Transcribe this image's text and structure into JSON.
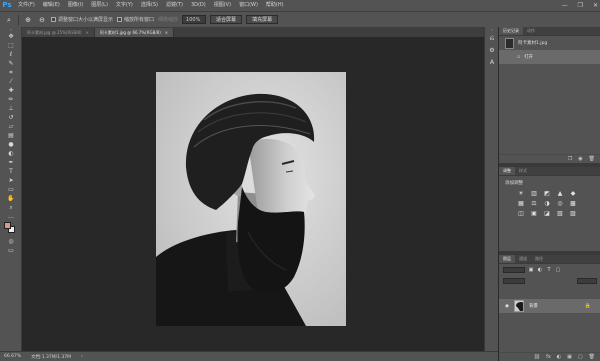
{
  "app": {
    "logo": "Ps"
  },
  "menu": {
    "items": [
      "文件(F)",
      "编辑(E)",
      "图像(I)",
      "图层(L)",
      "文字(Y)",
      "选择(S)",
      "滤镜(T)",
      "3D(D)",
      "视图(V)",
      "窗口(W)",
      "帮助(H)"
    ],
    "window_controls": [
      "—",
      "❐",
      "✕"
    ]
  },
  "options_bar": {
    "resize_windows_label": "调整窗口大小以满屏显示",
    "zoom_all_windows_label": "缩放所有窗口",
    "scrubby_zoom_label": "细微缩放",
    "zoom_value": "100%",
    "fit_screen_label": "适合屏幕",
    "fill_screen_label": "填充屏幕"
  },
  "tabs": [
    {
      "label": "阿卡素材.jpg @ 25%(RGB/8)",
      "active": false
    },
    {
      "label": "阿卡素材1.jpg @ 66.7%(RGB/8)",
      "active": true
    }
  ],
  "tools": [
    {
      "icon": "move-icon",
      "glyph": "✥"
    },
    {
      "icon": "marquee-icon",
      "glyph": "⬚"
    },
    {
      "icon": "lasso-icon",
      "glyph": "ℓ"
    },
    {
      "icon": "quick-select-icon",
      "glyph": "✎"
    },
    {
      "icon": "crop-icon",
      "glyph": "⌗"
    },
    {
      "icon": "eyedropper-icon",
      "glyph": "⁄"
    },
    {
      "icon": "healing-brush-icon",
      "glyph": "✚"
    },
    {
      "icon": "brush-icon",
      "glyph": "✏"
    },
    {
      "icon": "clone-stamp-icon",
      "glyph": "⊥"
    },
    {
      "icon": "history-brush-icon",
      "glyph": "↺"
    },
    {
      "icon": "eraser-icon",
      "glyph": "▱"
    },
    {
      "icon": "gradient-icon",
      "glyph": "▤"
    },
    {
      "icon": "blur-icon",
      "glyph": "●"
    },
    {
      "icon": "dodge-icon",
      "glyph": "◐"
    },
    {
      "icon": "pen-icon",
      "glyph": "✒"
    },
    {
      "icon": "type-icon",
      "glyph": "T"
    },
    {
      "icon": "path-select-icon",
      "glyph": "➤"
    },
    {
      "icon": "shape-icon",
      "glyph": "▭"
    },
    {
      "icon": "hand-icon",
      "glyph": "✋"
    },
    {
      "icon": "zoom-icon",
      "glyph": "⌕"
    },
    {
      "icon": "more-tools-icon",
      "glyph": "…"
    }
  ],
  "colors": {
    "foreground": "#d79a8c",
    "background": "#f2ecea",
    "accent": "#31a8ff"
  },
  "status": {
    "zoom": "66.67%",
    "doc_size": "文档:1.37M/1.37M"
  },
  "history_panel": {
    "tabs": [
      "历史记录",
      "动作"
    ],
    "items": [
      {
        "label": "阿卡素材1.jpg",
        "selected": false
      },
      {
        "label": "打开",
        "selected": true
      }
    ],
    "footer_icons": [
      "❐",
      "◉",
      "🗑"
    ]
  },
  "adjustments_panel": {
    "tabs": [
      "调整",
      "样式"
    ],
    "label": "添加调整",
    "icons": [
      "☀",
      "▥",
      "◩",
      "▲",
      "◆",
      "▦",
      "⚖",
      "◑",
      "◎",
      "▩",
      "◫",
      "▣",
      "◪",
      "▧",
      "▨"
    ]
  },
  "layers_panel": {
    "tabs": [
      "图层",
      "通道",
      "路径"
    ],
    "layer": {
      "name": "背景",
      "lock": "🔒"
    },
    "footer_icons": [
      "⛓",
      "fx",
      "◐",
      "▣",
      "▢",
      "🗑"
    ]
  }
}
